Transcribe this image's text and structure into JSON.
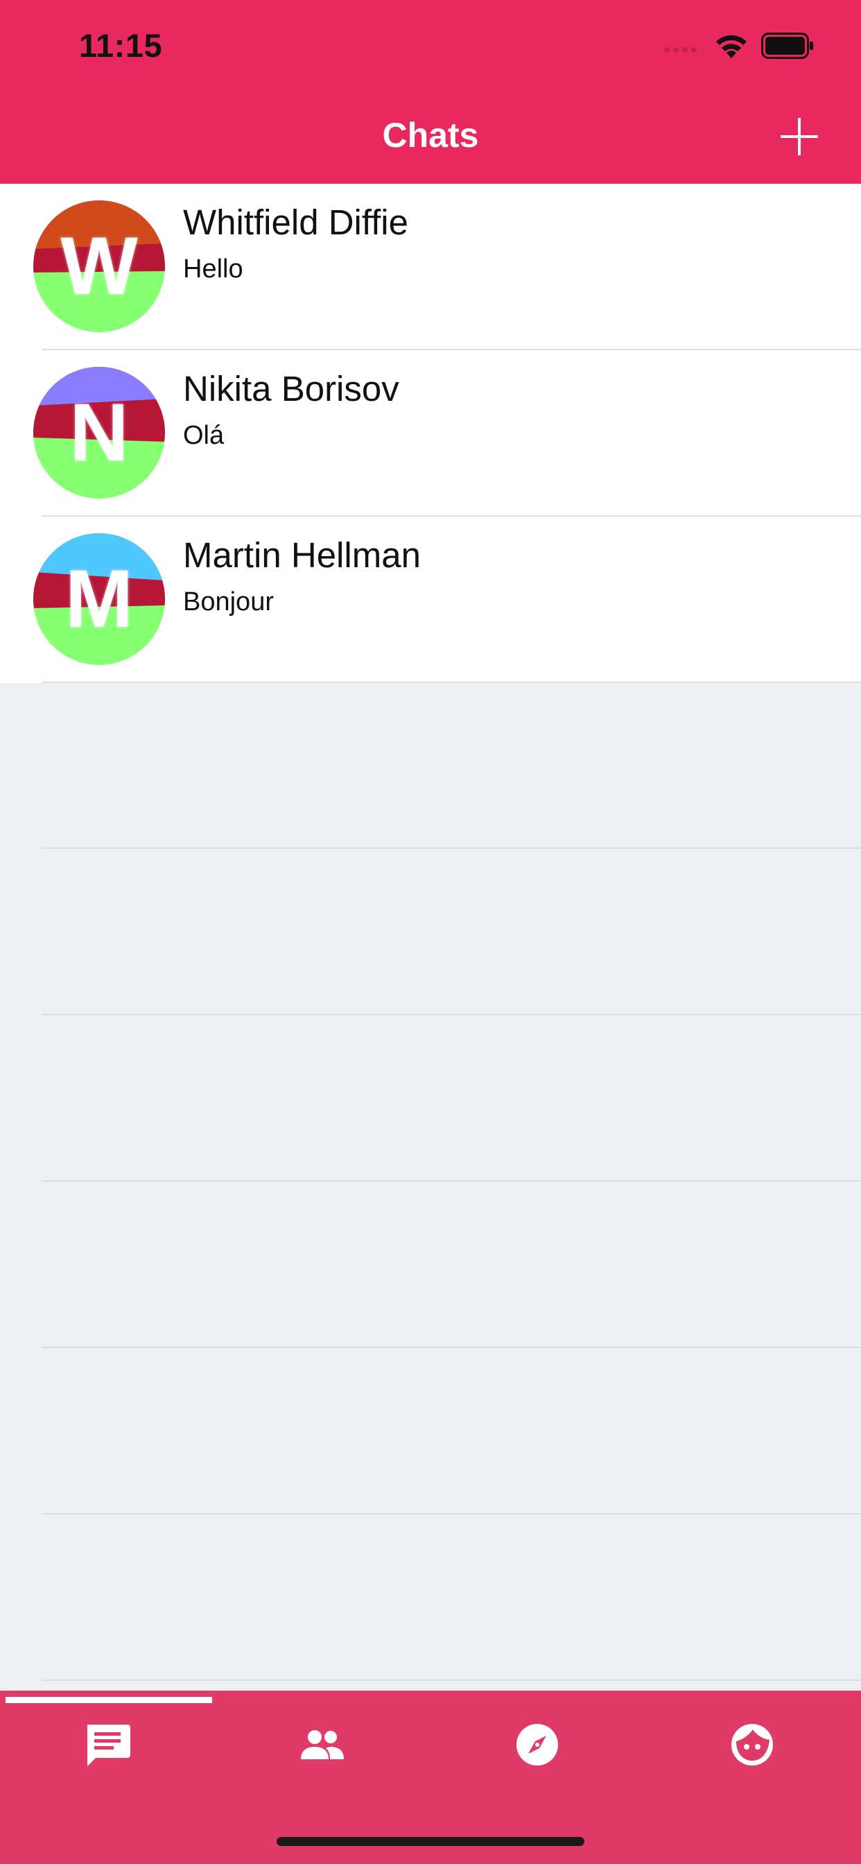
{
  "status_bar": {
    "time": "11:15"
  },
  "header": {
    "title": "Chats"
  },
  "chats": [
    {
      "name": "Whitfield Diffie",
      "message": "Hello",
      "initial": "W",
      "colors": [
        "#d04a1c",
        "#b51735",
        "#86ff73"
      ]
    },
    {
      "name": "Nikita Borisov",
      "message": "Olá",
      "initial": "N",
      "colors": [
        "#8a7cff",
        "#b51735",
        "#86ff73"
      ]
    },
    {
      "name": "Martin Hellman",
      "message": "Bonjour",
      "initial": "M",
      "colors": [
        "#4fc8ff",
        "#b51735",
        "#86ff73"
      ]
    }
  ],
  "tabs": [
    {
      "icon": "chat-bubble-icon",
      "selected": true
    },
    {
      "icon": "people-icon",
      "selected": false
    },
    {
      "icon": "compass-icon",
      "selected": false
    },
    {
      "icon": "face-icon",
      "selected": false
    }
  ],
  "colors": {
    "accent": "#e8285e",
    "tabbar": "#df3a68",
    "background": "#eff0f2"
  }
}
